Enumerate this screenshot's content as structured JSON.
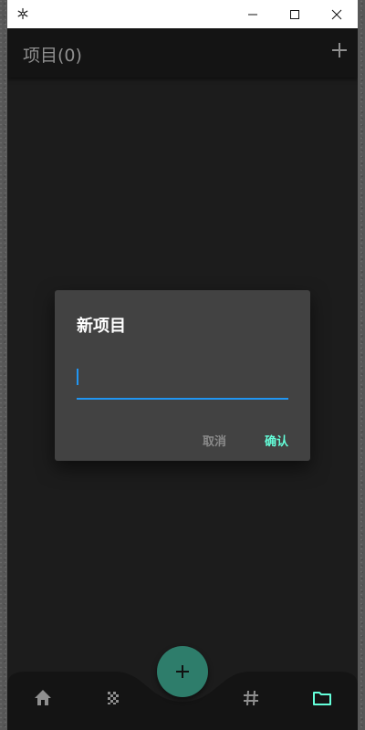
{
  "window": {
    "icon": "snowflake-icon",
    "controls": [
      "minimize-icon",
      "maximize-icon",
      "close-icon"
    ]
  },
  "appbar": {
    "title": "项目(0)",
    "action_icon": "plus-icon"
  },
  "dialog": {
    "title": "新项目",
    "input_value": "",
    "cancel_label": "取消",
    "confirm_label": "确认"
  },
  "bottom_nav": {
    "items": [
      "home-icon",
      "grid-icon",
      "fab-plus-icon",
      "hash-icon",
      "folder-icon"
    ],
    "active": "folder-icon"
  },
  "colors": {
    "accent": "#64ffda",
    "input_focus": "#2196f3",
    "fab": "#2e7d6b",
    "inactive_icon": "#8f8f8f",
    "surface": "#1c1c1c",
    "dialog": "#424242"
  }
}
